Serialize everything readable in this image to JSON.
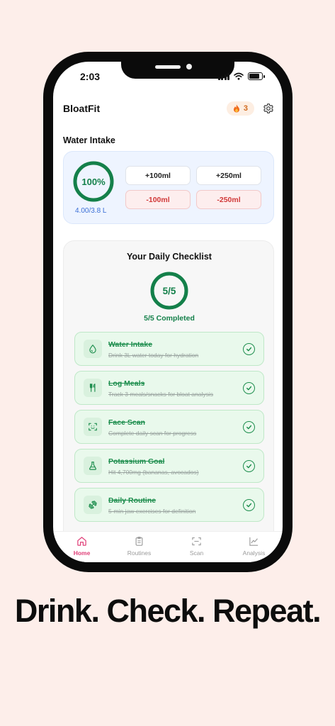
{
  "status": {
    "time": "2:03"
  },
  "app": {
    "title": "BloatFit",
    "streak_count": "3"
  },
  "water": {
    "section_label": "Water Intake",
    "percent_text": "100%",
    "progress": 1.0,
    "amount_text": "4.00/3.8 L",
    "buttons": {
      "add_100": "+100ml",
      "add_250": "+250ml",
      "sub_100": "-100ml",
      "sub_250": "-250ml"
    }
  },
  "checklist": {
    "title": "Your Daily Checklist",
    "ring_text": "5/5",
    "progress": 1.0,
    "completed_text": "5/5 Completed",
    "items": [
      {
        "name": "Water Intake",
        "desc": "Drink 3L water today for hydration",
        "icon": "water-drop-icon"
      },
      {
        "name": "Log Meals",
        "desc": "Track 3 meals/snacks for bloat analysis",
        "icon": "fork-knife-icon"
      },
      {
        "name": "Face Scan",
        "desc": "Complete daily scan for progress",
        "icon": "face-scan-icon"
      },
      {
        "name": "Potassium Goal",
        "desc": "Hit 4,700mg (bananas, avocados)",
        "icon": "flask-icon"
      },
      {
        "name": "Daily Routine",
        "desc": "5-min jaw exercises for definition",
        "icon": "dumbbell-icon"
      }
    ]
  },
  "tabs": [
    {
      "label": "Home",
      "icon": "home-icon",
      "active": true
    },
    {
      "label": "Routines",
      "icon": "clipboard-icon",
      "active": false
    },
    {
      "label": "Scan",
      "icon": "scan-icon",
      "active": false
    },
    {
      "label": "Analysis",
      "icon": "chart-icon",
      "active": false
    }
  ],
  "colors": {
    "accent_green": "#14804a",
    "accent_pink": "#e0427a",
    "water_blue": "#3b6fd6",
    "danger_red": "#d13838"
  },
  "tagline": "Drink. Check. Repeat."
}
